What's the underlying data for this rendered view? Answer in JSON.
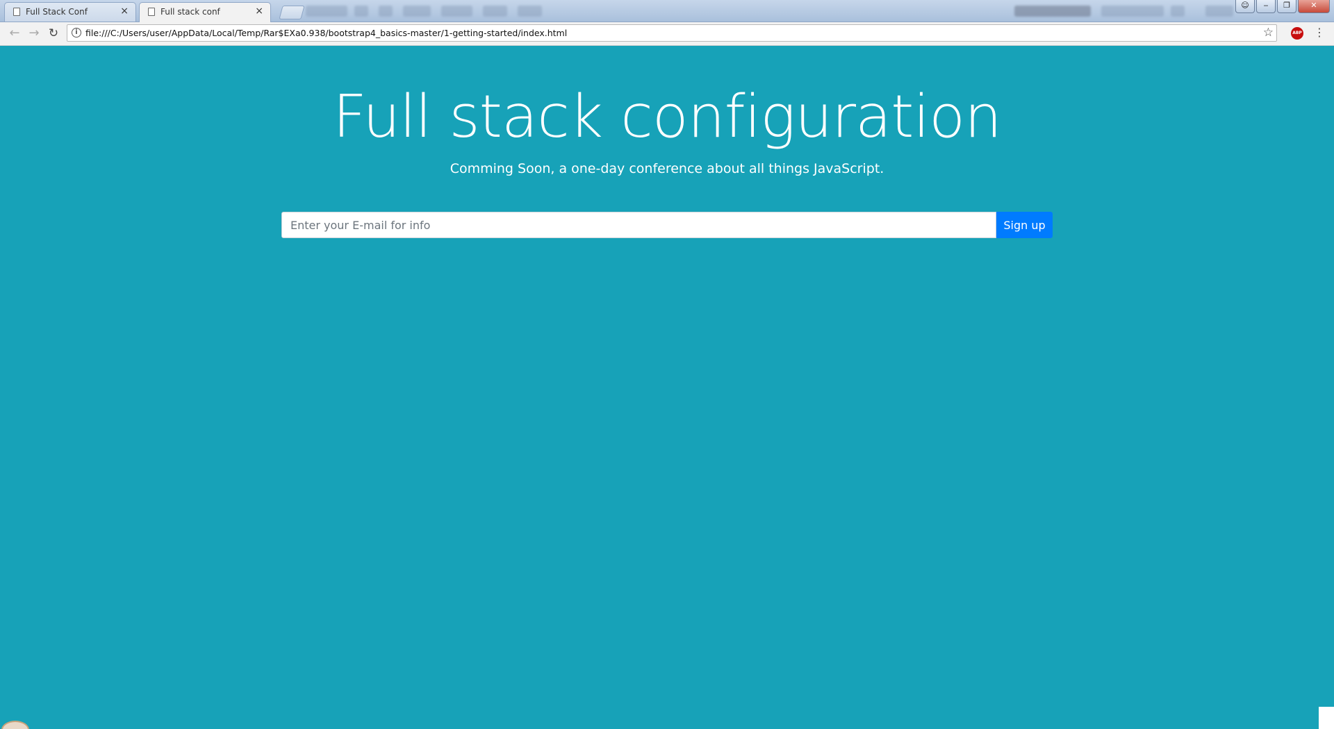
{
  "browser": {
    "tabs": [
      {
        "title": "Full Stack Conf",
        "close": "×"
      },
      {
        "title": "Full stack conf",
        "close": "×"
      }
    ],
    "window_controls": {
      "minimize": "‒",
      "restore": "❐",
      "close": "✕"
    },
    "toolbar": {
      "back": "←",
      "forward": "→",
      "reload": "↻",
      "url": "file:///C:/Users/user/AppData/Local/Temp/Rar$EXa0.938/bootstrap4_basics-master/1-getting-started/index.html",
      "info_glyph": "i",
      "star": "☆",
      "abp": "ABP",
      "menu": "⋮"
    }
  },
  "page": {
    "title": "Full stack configuration",
    "subtitle": "Comming Soon, a one-day conference about all things JavaScript.",
    "email_placeholder": "Enter your E-mail for info",
    "signup_label": "Sign up"
  },
  "colors": {
    "background": "#17a2b8",
    "primary_button": "#007bff"
  },
  "icons": [
    "page-icon",
    "close-icon",
    "back-arrow-icon",
    "forward-arrow-icon",
    "reload-icon",
    "info-icon",
    "star-icon",
    "adblock-icon",
    "menu-icon"
  ]
}
